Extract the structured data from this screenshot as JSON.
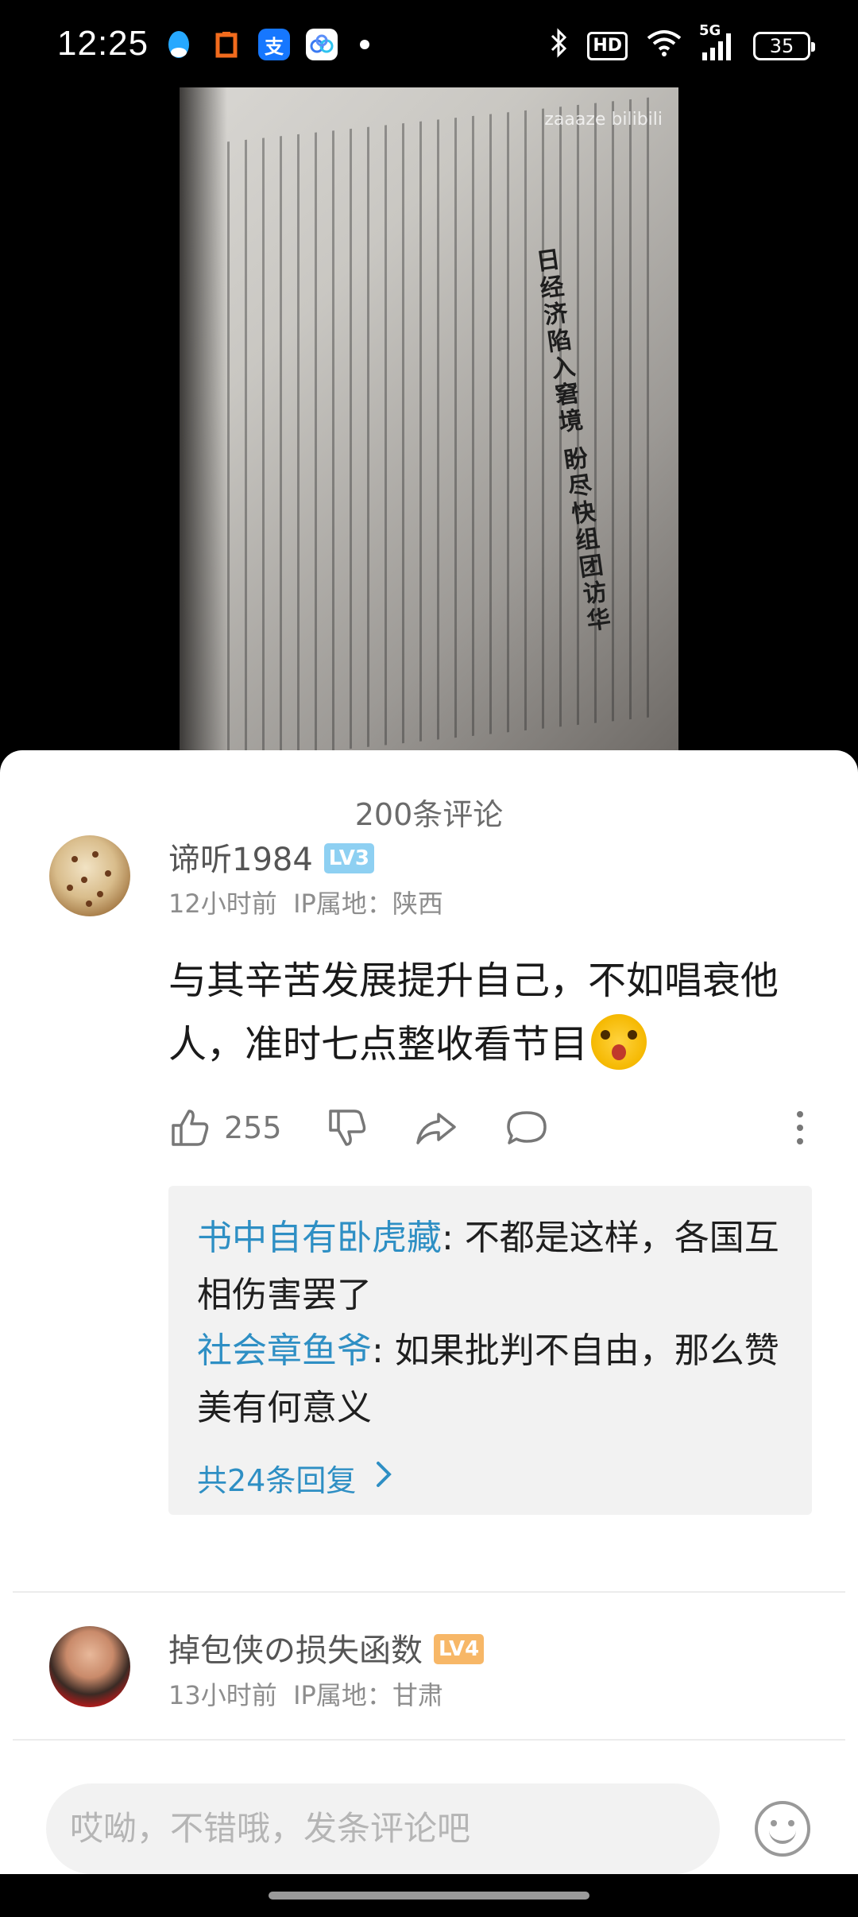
{
  "status_bar": {
    "time": "12:25",
    "notifications": [
      "qq-icon",
      "office-icon",
      "alipay-icon",
      "baidu-cloud-icon"
    ],
    "hd": "HD",
    "network": "5G",
    "battery": "35"
  },
  "video": {
    "watermark": "zaaaze bilibili",
    "headline": "日经济陷入窘境 盼尽快组团访华"
  },
  "comments": {
    "count_label": "200条评论",
    "items": [
      {
        "username": "谛听1984",
        "level": "LV3",
        "time": "12小时前",
        "ip": "IP属地：陕西",
        "text": "与其辛苦发展提升自己，不如唱衰他人，准时七点整收看节目",
        "likes": "255",
        "replies": [
          {
            "user": "书中自有卧虎藏",
            "text": ": 不都是这样，各国互相伤害罢了"
          },
          {
            "user": "社会章鱼爷",
            "text": ": 如果批判不自由，那么赞美有何意义"
          }
        ],
        "more_replies": "共24条回复"
      },
      {
        "username": "掉包侠の损失函数",
        "level": "LV4",
        "time": "13小时前",
        "ip": "IP属地：甘肃"
      }
    ]
  },
  "input": {
    "placeholder": "哎呦，不错哦，发条评论吧"
  },
  "colors": {
    "link": "#2e8fc4",
    "lv3": "#8ed0f2",
    "lv4": "#f7b767"
  }
}
